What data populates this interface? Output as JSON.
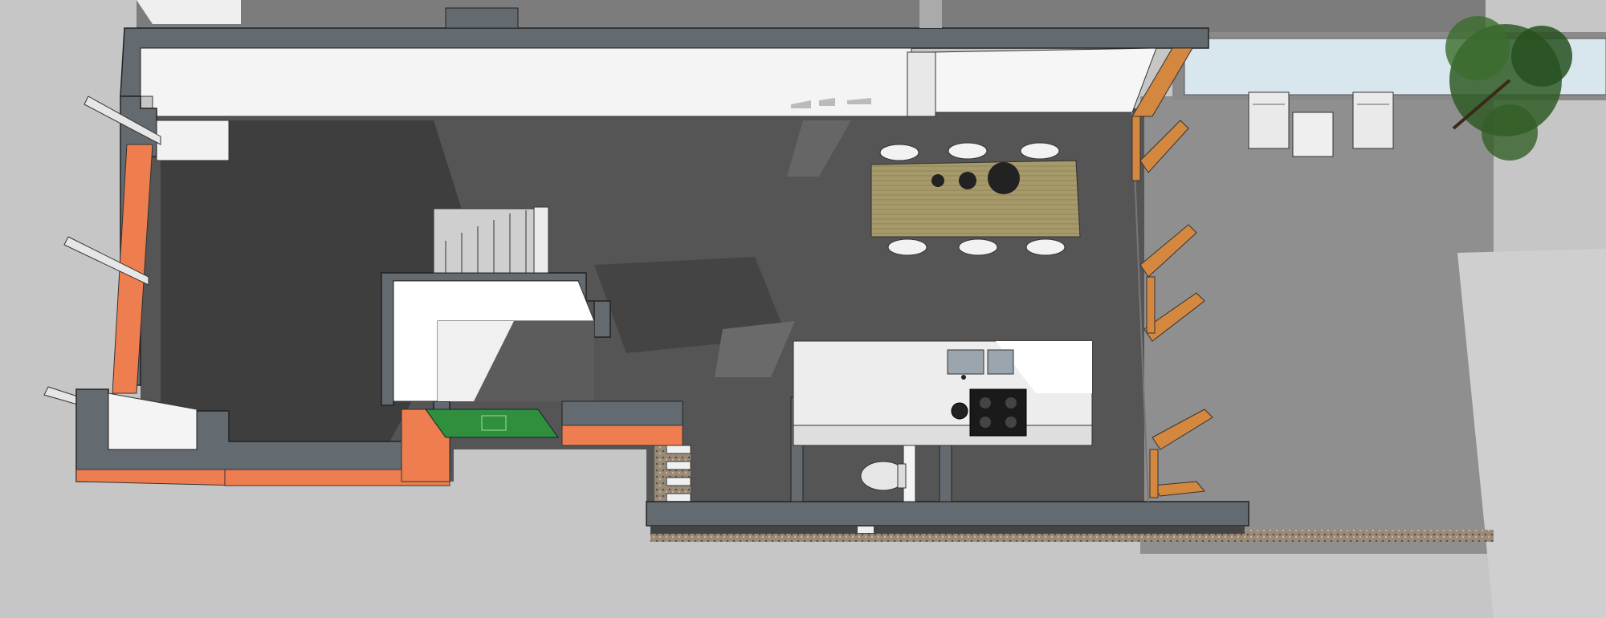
{
  "scene": {
    "kind": "3d-model-plan-view",
    "labels": []
  },
  "palette": {
    "ground": "#c6c6c6",
    "paving": "#8f8f8f",
    "interior_floor": "#555555",
    "floor_shadow": "#3e3e3e",
    "wall_top": "#636a70",
    "wall_face": "#f4f4f4",
    "brick": "#ee7e4f",
    "timber_frame": "#d4873f",
    "table_wood": "#a79a6a",
    "door_green": "#2f8f3c",
    "glass": "#d8e6ee",
    "tree": "#2f5a24"
  },
  "objects": [
    {
      "name": "dining-table",
      "seats": 6
    },
    {
      "name": "kitchen-island",
      "hob_burners": 4,
      "sinks": 2
    },
    {
      "name": "staircase",
      "steps": 8
    },
    {
      "name": "wc"
    },
    {
      "name": "bifold-door-frames",
      "count": 4
    },
    {
      "name": "garden-chairs",
      "count": 2
    },
    {
      "name": "tree"
    },
    {
      "name": "front-door"
    }
  ]
}
